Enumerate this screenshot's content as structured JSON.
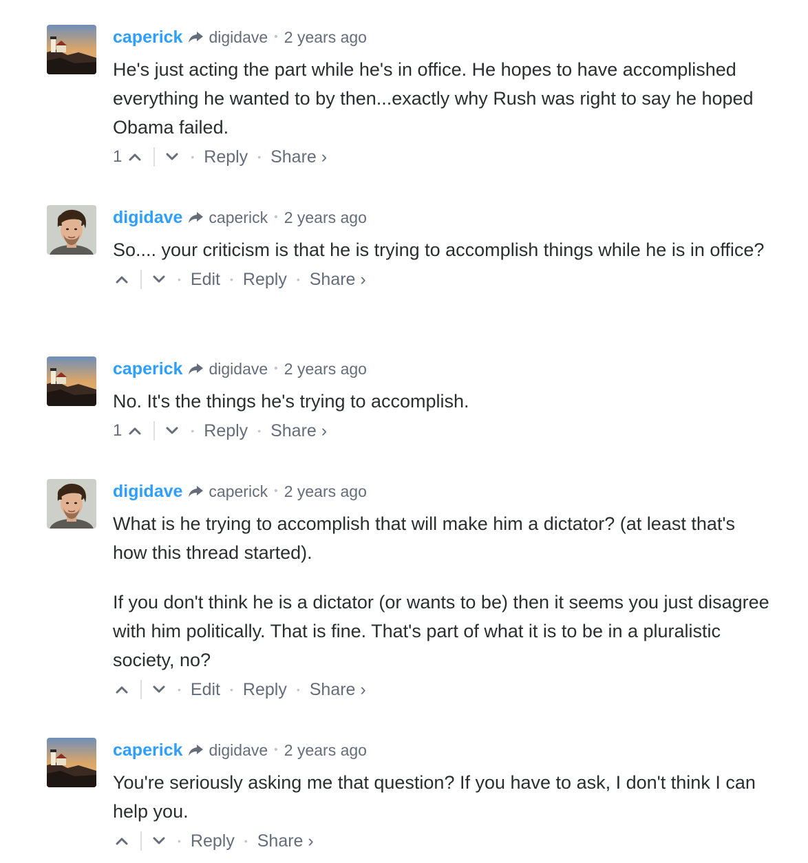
{
  "comments": [
    {
      "author": "caperick",
      "avatar": "lighthouse-avatar",
      "reply_to": "digidave",
      "time": "2 years ago",
      "paragraphs": [
        "He's just acting the part while he's in office. He hopes to have accomplished everything he wanted to by then...exactly why Rush was right to say he hoped Obama failed."
      ],
      "votes": "1",
      "actions": [
        "Reply",
        "Share ›"
      ]
    },
    {
      "author": "digidave",
      "avatar": "man-avatar",
      "reply_to": "caperick",
      "time": "2 years ago",
      "paragraphs": [
        "So.... your criticism is that he is trying to accomplish things while he is in office?"
      ],
      "votes": "",
      "actions": [
        "Edit",
        "Reply",
        "Share ›"
      ]
    },
    {
      "author": "caperick",
      "avatar": "lighthouse-avatar",
      "reply_to": "digidave",
      "time": "2 years ago",
      "paragraphs": [
        "No. It's the things he's trying to accomplish."
      ],
      "votes": "1",
      "actions": [
        "Reply",
        "Share ›"
      ]
    },
    {
      "author": "digidave",
      "avatar": "man-avatar",
      "reply_to": "caperick",
      "time": "2 years ago",
      "paragraphs": [
        "What is he trying to accomplish that will make him a dictator? (at least that's how this thread started).",
        "If you don't think he is a dictator (or wants to be) then it seems you just disagree with him politically. That is fine. That's part of what it is to be in a pluralistic society, no?"
      ],
      "votes": "",
      "actions": [
        "Edit",
        "Reply",
        "Share ›"
      ]
    },
    {
      "author": "caperick",
      "avatar": "lighthouse-avatar",
      "reply_to": "digidave",
      "time": "2 years ago",
      "paragraphs": [
        "You're seriously asking me that question? If you have to ask, I don't think I can help you."
      ],
      "votes": "",
      "actions": [
        "Reply",
        "Share ›"
      ]
    }
  ],
  "colors": {
    "author": "#2e9fff",
    "meta": "#656c7a",
    "text": "#2a2e2e",
    "separator": "#dbdfe4"
  }
}
